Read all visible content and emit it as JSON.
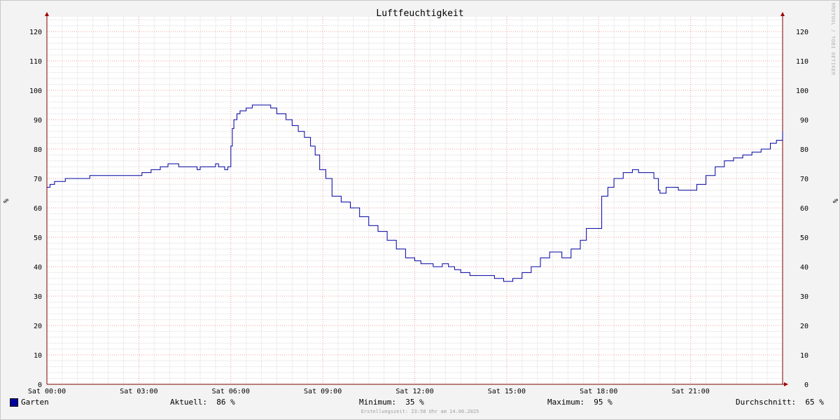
{
  "chart_data": {
    "type": "line",
    "title": "Luftfeuchtigkeit",
    "ylabel": "%",
    "ylim": [
      0,
      125
    ],
    "yticks": [
      0,
      10,
      20,
      30,
      40,
      50,
      60,
      70,
      80,
      90,
      100,
      110,
      120
    ],
    "xlim_hours": [
      0,
      24
    ],
    "xticks": [
      {
        "h": 0,
        "label": "Sat 00:00"
      },
      {
        "h": 3,
        "label": "Sat 03:00"
      },
      {
        "h": 6,
        "label": "Sat 06:00"
      },
      {
        "h": 9,
        "label": "Sat 09:00"
      },
      {
        "h": 12,
        "label": "Sat 12:00"
      },
      {
        "h": 15,
        "label": "Sat 15:00"
      },
      {
        "h": 18,
        "label": "Sat 18:00"
      },
      {
        "h": 21,
        "label": "Sat 21:00"
      }
    ],
    "grid": true,
    "series": [
      {
        "name": "Garten",
        "color": "#0000a0",
        "x": [
          0.0,
          0.1,
          0.25,
          0.6,
          1.0,
          1.4,
          1.8,
          2.2,
          2.6,
          2.9,
          3.1,
          3.4,
          3.7,
          3.95,
          4.0,
          4.3,
          4.7,
          4.9,
          5.0,
          5.4,
          5.5,
          5.6,
          5.8,
          5.9,
          6.0,
          6.05,
          6.1,
          6.2,
          6.3,
          6.5,
          6.7,
          7.0,
          7.3,
          7.5,
          7.8,
          8.0,
          8.2,
          8.4,
          8.6,
          8.75,
          8.9,
          9.1,
          9.3,
          9.6,
          9.9,
          10.2,
          10.5,
          10.8,
          11.1,
          11.4,
          11.7,
          12.0,
          12.2,
          12.4,
          12.6,
          12.9,
          13.1,
          13.3,
          13.5,
          13.8,
          14.2,
          14.6,
          14.9,
          15.2,
          15.5,
          15.8,
          16.1,
          16.4,
          16.8,
          17.1,
          17.4,
          17.6,
          17.75,
          17.9,
          18.1,
          18.3,
          18.5,
          18.8,
          19.1,
          19.3,
          19.6,
          19.8,
          19.95,
          20.0,
          20.2,
          20.6,
          20.9,
          21.2,
          21.5,
          21.8,
          22.1,
          22.4,
          22.7,
          23.0,
          23.3,
          23.6,
          23.8,
          24.0
        ],
        "values": [
          67,
          68,
          69,
          70,
          70,
          71,
          71,
          71,
          71,
          71,
          72,
          73,
          74,
          75,
          75,
          74,
          74,
          73,
          74,
          74,
          75,
          74,
          73,
          74,
          81,
          87,
          90,
          92,
          93,
          94,
          95,
          95,
          94,
          92,
          90,
          88,
          86,
          84,
          81,
          78,
          73,
          70,
          64,
          62,
          60,
          57,
          54,
          52,
          49,
          46,
          43,
          42,
          41,
          41,
          40,
          41,
          40,
          39,
          38,
          37,
          37,
          36,
          35,
          36,
          38,
          40,
          43,
          45,
          43,
          46,
          49,
          53,
          53,
          53,
          64,
          67,
          70,
          72,
          73,
          72,
          72,
          70,
          66,
          65,
          67,
          66,
          66,
          68,
          71,
          74,
          76,
          77,
          78,
          79,
          80,
          82,
          83,
          86
        ]
      }
    ]
  },
  "legend": {
    "series_label": "Garten",
    "current": "Aktuell:  86 %",
    "minimum": "Minimum:  35 %",
    "maximum": "Maximum:  95 %",
    "average": "Durchschnitt:  65 %"
  },
  "footer": "Erstellungszeit: 23:58 Uhr am 14.06.2025",
  "watermark": "RRDTOOL / TOBI OETIKER"
}
